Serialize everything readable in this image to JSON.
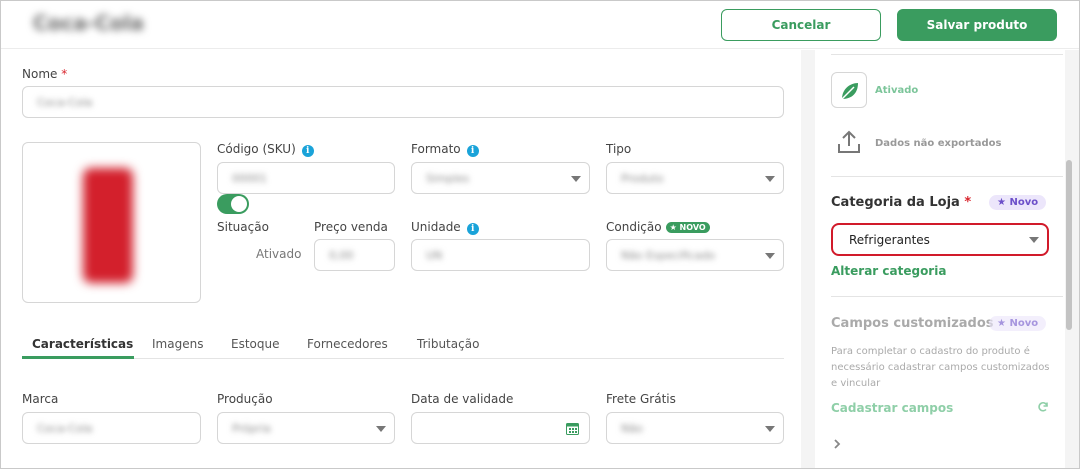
{
  "header": {
    "title": "Coca-Cola",
    "cancel_label": "Cancelar",
    "save_label": "Salvar produto"
  },
  "form": {
    "name_label": "Nome",
    "name_value": "Coca-Cola",
    "sku_label": "Código (SKU)",
    "sku_value": "00001",
    "formato_label": "Formato",
    "formato_value": "Simples",
    "tipo_label": "Tipo",
    "tipo_value": "Produto",
    "situacao_label": "Situação",
    "situacao_value": "Ativado",
    "preco_label": "Preço venda",
    "preco_value": "0,00",
    "unidade_label": "Unidade",
    "unidade_value": "UN",
    "condicao_label": "Condição",
    "condicao_badge": "NOVO",
    "condicao_value": "Não Especificado"
  },
  "tabs": [
    {
      "label": "Características"
    },
    {
      "label": "Imagens"
    },
    {
      "label": "Estoque"
    },
    {
      "label": "Fornecedores"
    },
    {
      "label": "Tributação"
    }
  ],
  "caracteristicas": {
    "marca_label": "Marca",
    "marca_value": "Coca-Cola",
    "producao_label": "Produção",
    "producao_value": "Própria",
    "validade_label": "Data de validade",
    "frete_label": "Frete Grátis",
    "frete_value": "Não"
  },
  "sidebar": {
    "status_text": "Ativado",
    "export_text": "Dados não exportados",
    "categoria_title": "Categoria da Loja",
    "novo_badge": "Novo",
    "categoria_value": "Refrigerantes",
    "alterar_link": "Alterar categoria",
    "campos_title": "Campos customizados",
    "campos_badge": "Novo",
    "campos_desc": "Para completar o cadastro do produto é necessário cadastrar campos customizados e vincular",
    "cadastrar_link": "Cadastrar campos"
  },
  "colors": {
    "accent": "#3a9c5f",
    "highlight": "#d11a2a",
    "info": "#1aa3d9",
    "novo_purple": "#6c4fc9"
  }
}
